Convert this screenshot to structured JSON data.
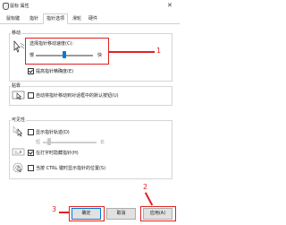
{
  "window": {
    "title": "鼠标 属性"
  },
  "tabs": [
    {
      "label": "鼠标键"
    },
    {
      "label": "指针"
    },
    {
      "label": "指针选项"
    },
    {
      "label": "滑轮"
    },
    {
      "label": "硬件"
    }
  ],
  "motion": {
    "group_title": "移动",
    "speed_label": "选择指针移动速度(C):",
    "slow_label": "慢",
    "fast_label": "快",
    "speed_level": 0.45,
    "precision_label": "提高指针精确度(E)"
  },
  "snap": {
    "group_title": "贴靠",
    "label": "自动将指针移动到对话框中的默认按钮(U)"
  },
  "visibility": {
    "group_title": "可见性",
    "trails_label": "显示指针轨迹(D)",
    "trails_short": "短",
    "trails_long": "长",
    "hide_label": "在打字时隐藏指针(H)",
    "ctrl_label": "当按 CTRL 键时显示指针的位置(S)"
  },
  "buttons": {
    "ok": "确定",
    "cancel": "取消",
    "apply": "应用(A)"
  },
  "annotations": {
    "n1": "1",
    "n2": "2",
    "n3": "3",
    "color": "#e02020"
  }
}
